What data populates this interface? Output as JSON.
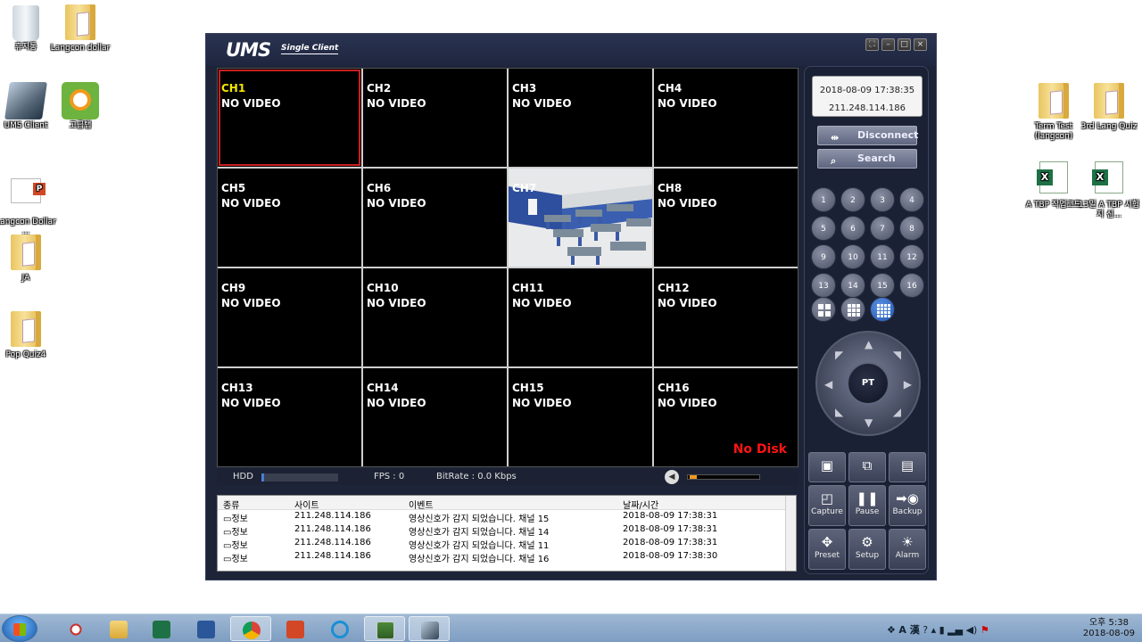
{
  "desktop": {
    "left_icons": [
      {
        "label": "휴지통",
        "icon": "recycle-bin-icon"
      },
      {
        "label": "Langcon dollar",
        "icon": "folder-icon"
      },
      {
        "label": "UMS Client",
        "icon": "ums-client-icon"
      },
      {
        "label": "고급탭",
        "icon": "app-icon"
      },
      {
        "label": "Langcon Dollar ...",
        "icon": "powerpoint-file-icon"
      },
      {
        "label": "JA",
        "icon": "folder-icon"
      },
      {
        "label": "Pop Quiz4",
        "icon": "folder-icon"
      }
    ],
    "right_icons": [
      {
        "label": "Term Test (langcon)",
        "icon": "folder-icon"
      },
      {
        "label": "3rd Lang Quiz",
        "icon": "folder-icon"
      },
      {
        "label": "A TBP 작업코드",
        "icon": "excel-file-icon"
      },
      {
        "label": "13일 A TBP 시험지 신...",
        "icon": "excel-file-icon"
      }
    ]
  },
  "app": {
    "logo": "UMS",
    "logo_sub": "Single Client",
    "window_buttons": [
      "⛶",
      "–",
      "□",
      "×"
    ],
    "channels": [
      {
        "name": "CH1",
        "status": "NO VIDEO"
      },
      {
        "name": "CH2",
        "status": "NO VIDEO"
      },
      {
        "name": "CH3",
        "status": "NO VIDEO"
      },
      {
        "name": "CH4",
        "status": "NO VIDEO"
      },
      {
        "name": "CH5",
        "status": "NO VIDEO"
      },
      {
        "name": "CH6",
        "status": "NO VIDEO"
      },
      {
        "name": "CH7",
        "status": ""
      },
      {
        "name": "CH8",
        "status": "NO VIDEO"
      },
      {
        "name": "CH9",
        "status": "NO VIDEO"
      },
      {
        "name": "CH10",
        "status": "NO VIDEO"
      },
      {
        "name": "CH11",
        "status": "NO VIDEO"
      },
      {
        "name": "CH12",
        "status": "NO VIDEO"
      },
      {
        "name": "CH13",
        "status": "NO VIDEO"
      },
      {
        "name": "CH14",
        "status": "NO VIDEO"
      },
      {
        "name": "CH15",
        "status": "NO VIDEO"
      },
      {
        "name": "CH16",
        "status": "NO VIDEO"
      }
    ],
    "no_disk": "No Disk",
    "status": {
      "hdd_label": "HDD",
      "fps": "FPS :  0",
      "bitrate": "BitRate :  0.0 Kbps"
    },
    "log": {
      "headers": [
        "종류",
        "사이트",
        "이벤트",
        "날짜/시간"
      ],
      "rows": [
        {
          "type": "정보",
          "site": "211.248.114.186",
          "event": "영상신호가 감지 되었습니다. 채널 15",
          "time": "2018-08-09 17:38:31"
        },
        {
          "type": "정보",
          "site": "211.248.114.186",
          "event": "영상신호가 감지 되었습니다. 채널 14",
          "time": "2018-08-09 17:38:31"
        },
        {
          "type": "정보",
          "site": "211.248.114.186",
          "event": "영상신호가 감지 되었습니다. 채널 11",
          "time": "2018-08-09 17:38:31"
        },
        {
          "type": "정보",
          "site": "211.248.114.186",
          "event": "영상신호가 감지 되었습니다. 채널 16",
          "time": "2018-08-09 17:38:30"
        }
      ]
    },
    "right_panel": {
      "datetime": "2018-08-09 17:38:35",
      "ip": "211.248.114.186",
      "disconnect_label": "Disconnect",
      "search_label": "Search",
      "channel_buttons": [
        "1",
        "2",
        "3",
        "4",
        "5",
        "6",
        "7",
        "8",
        "9",
        "10",
        "11",
        "12",
        "13",
        "14",
        "15",
        "16"
      ],
      "ptz_label": "PT",
      "tool_buttons": [
        {
          "label": "",
          "icon": "display-mode-1-icon"
        },
        {
          "label": "",
          "icon": "display-mode-2-icon"
        },
        {
          "label": "",
          "icon": "display-mode-3-icon"
        },
        {
          "label": "Capture",
          "icon": "capture-icon"
        },
        {
          "label": "Pause",
          "icon": "pause-icon"
        },
        {
          "label": "Backup",
          "icon": "backup-icon"
        },
        {
          "label": "Preset",
          "icon": "preset-icon"
        },
        {
          "label": "Setup",
          "icon": "setup-icon"
        },
        {
          "label": "Alarm",
          "icon": "alarm-icon"
        }
      ]
    }
  },
  "taskbar": {
    "apps": [
      "search-tool-icon",
      "file-explorer-icon",
      "excel-icon",
      "word-icon",
      "chrome-icon",
      "powerpoint-icon",
      "internet-explorer-icon",
      "ums-monitor-icon",
      "ums-client-icon"
    ],
    "tray_ime": "A 漢",
    "clock_time": "오후 5:38",
    "clock_date": "2018-08-09"
  }
}
